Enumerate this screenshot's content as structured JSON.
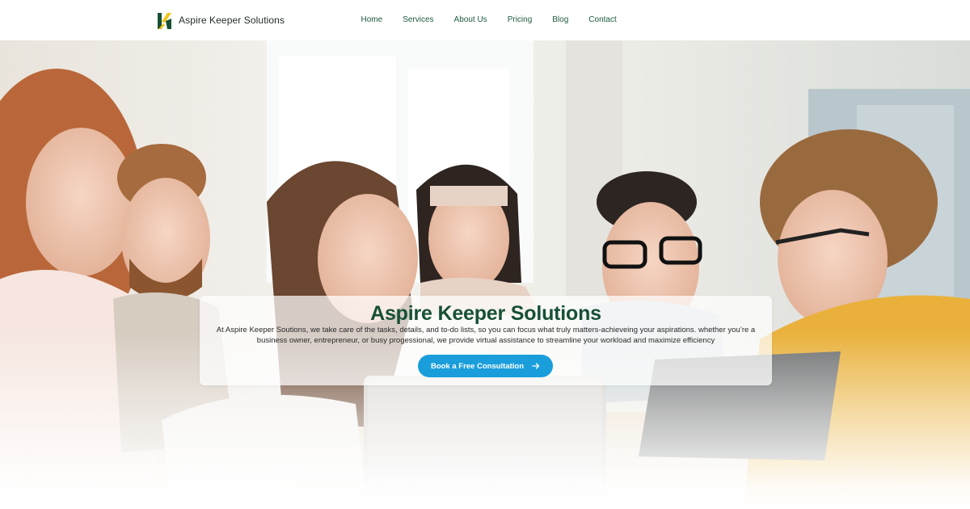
{
  "brand": {
    "name": "Aspire Keeper Solutions",
    "logo_icon": "ak-monogram-icon",
    "colors": {
      "green": "#175035",
      "gold": "#f2c214"
    }
  },
  "nav": {
    "items": [
      {
        "label": "Home"
      },
      {
        "label": "Services"
      },
      {
        "label": "About Us"
      },
      {
        "label": "Pricing"
      },
      {
        "label": "Blog"
      },
      {
        "label": "Contact"
      }
    ]
  },
  "hero": {
    "title": "Aspire Keeper Solutions",
    "description": "At Aspire Keeper Soutions, we take care of the tasks, details, and to-do lists, so you can focus what truly matters-achieveing your aspirations. whether you’re a business owner, entrepreneur, or busy progessional, we provide virtual assistance to streamline your workload and maximize efficiency",
    "cta": {
      "label": "Book a Free Consultation",
      "icon": "arrow-right-icon",
      "color": "#1a9edb"
    }
  }
}
